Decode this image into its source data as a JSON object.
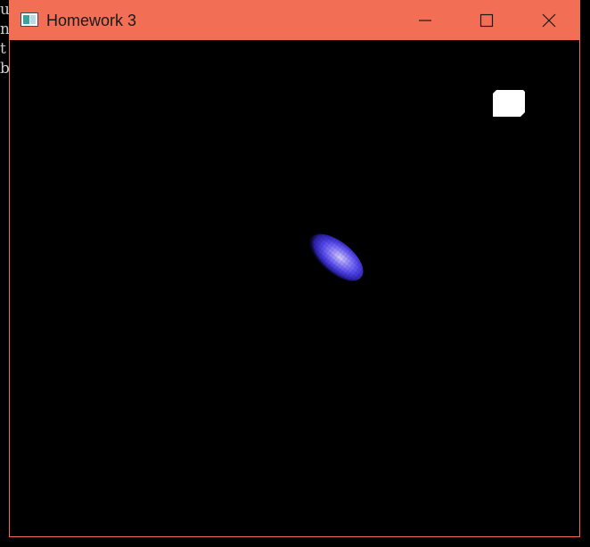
{
  "background_console": {
    "lines": [
      "u",
      "n",
      "t",
      "b"
    ]
  },
  "window": {
    "title": "Homework 3",
    "titlebar_color": "#f26f55",
    "app_icon": "window-app-icon",
    "controls": {
      "minimize": "minimize-icon",
      "maximize": "maximize-icon",
      "close": "close-icon"
    }
  },
  "scene": {
    "background_color": "#000000",
    "light_color": "#ffffff",
    "sphere_color": "#7a6cff",
    "objects": [
      "light-source",
      "lit-sphere"
    ]
  }
}
